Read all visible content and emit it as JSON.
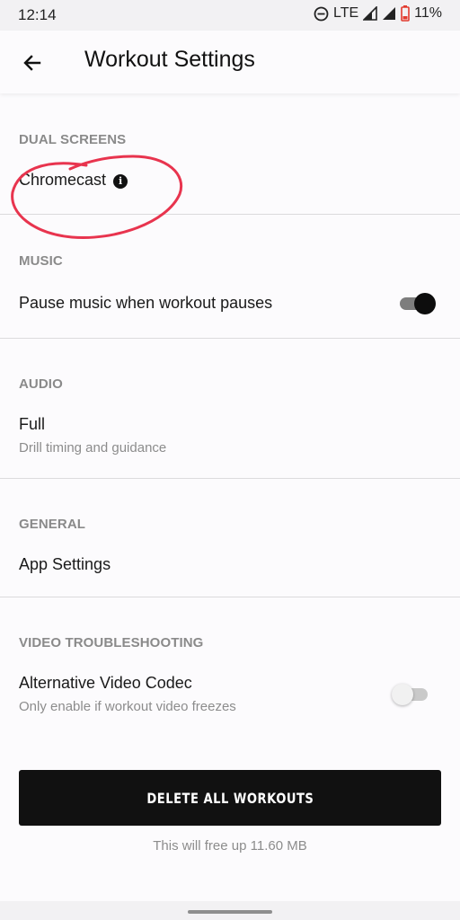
{
  "status_bar": {
    "time": "12:14",
    "network": "LTE",
    "battery": "11%"
  },
  "header": {
    "title": "Workout Settings",
    "back_icon": "arrow-left-icon"
  },
  "sections": {
    "dual_screens": {
      "header": "DUAL SCREENS",
      "item_label": "Chromecast",
      "info_icon": "i"
    },
    "music": {
      "header": "MUSIC",
      "item_label": "Pause music when workout pauses",
      "toggle_on": true
    },
    "audio": {
      "header": "AUDIO",
      "item_label": "Full",
      "item_sub": "Drill timing and guidance"
    },
    "general": {
      "header": "GENERAL",
      "item_label": "App Settings"
    },
    "video": {
      "header": "VIDEO TROUBLESHOOTING",
      "item_label": "Alternative Video Codec",
      "item_sub": "Only enable if workout video freezes",
      "toggle_on": false
    }
  },
  "delete": {
    "button_label": "DELETE ALL WORKOUTS",
    "note": "This will free up 11.60 MB"
  },
  "colors": {
    "accent": "#111111",
    "annotation": "#e8344e",
    "section_header": "#8a8a8a"
  }
}
